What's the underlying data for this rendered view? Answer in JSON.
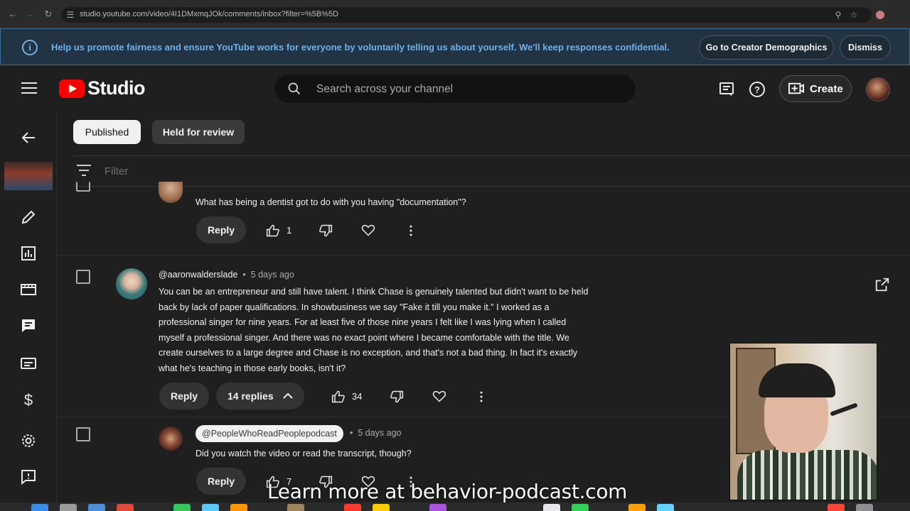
{
  "browser": {
    "url": "studio.youtube.com/video/4I1DMxmqJOk/comments/inbox?filter=%5B%5D"
  },
  "banner": {
    "message": "Help us promote fairness and ensure YouTube works for everyone by voluntarily telling us about yourself. We'll keep responses confidential.",
    "demographics_button": "Go to Creator Demographics",
    "dismiss_button": "Dismiss"
  },
  "header": {
    "logo_text": "Studio",
    "search_placeholder": "Search across your channel",
    "create_label": "Create"
  },
  "tabs": {
    "published": "Published",
    "held": "Held for review"
  },
  "filter": {
    "label": "Filter"
  },
  "comments": [
    {
      "text": "What has being a dentist got to do with you having \"documentation\"?",
      "reply_label": "Reply",
      "likes": "1"
    },
    {
      "author": "@aaronwalderslade",
      "time": "5 days ago",
      "text": "You can be an entrepreneur and still have talent. I think Chase is genuinely talented but didn't want to be held back by lack of paper qualifications. In showbusiness we say \"Fake it till you make it.\" I worked as a professional singer for nine years. For at least five of those nine years I felt like I was lying when I called myself a professional singer. And there was no exact point where I became comfortable with the title. We create ourselves to a large degree and Chase is no exception, and that's not a bad thing. In fact it's exactly what he's teaching in those early books, isn't it?",
      "reply_label": "Reply",
      "replies_label": "14 replies",
      "likes": "34"
    },
    {
      "author": "@PeopleWhoReadPeoplepodcast",
      "time": "5 days ago",
      "text": "Did you watch the video or read the transcript, though?",
      "reply_label": "Reply",
      "likes": "7"
    }
  ],
  "overlay": {
    "caption": "Learn more at behavior-podcast.com"
  },
  "colors": {
    "accent_blue": "#6fb0e8",
    "brand_red": "#ff0000",
    "background": "#1f1f1f"
  }
}
